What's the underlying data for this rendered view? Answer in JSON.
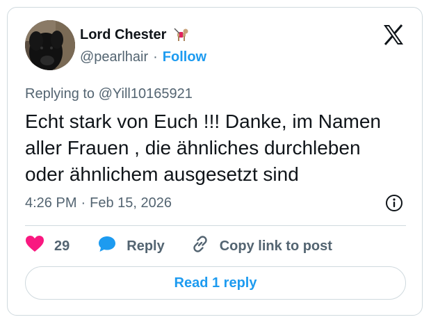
{
  "author": {
    "display_name": "Lord Chester",
    "name_emoji_icon": "guide-dog-icon",
    "handle": "@pearlhair",
    "separator": "·",
    "follow_label": "Follow"
  },
  "platform_icon": "x-logo-icon",
  "reply_context": {
    "prefix": "Replying to ",
    "mention": "@Yill10165921"
  },
  "tweet": {
    "text": "Echt stark von Euch !!! Danke, im Namen\naller Frauen , die ähnliches durchleben\noder ähnlichem ausgesetzt sind"
  },
  "meta": {
    "time": "4:26 PM",
    "separator": "·",
    "date": "Feb 15, 2026",
    "info_icon": "info-icon"
  },
  "actions": {
    "like_count": "29",
    "like_icon": "heart-icon",
    "reply_label": "Reply",
    "reply_icon": "speech-bubble-icon",
    "copy_label": "Copy link to post",
    "copy_icon": "link-icon"
  },
  "read_replies_label": "Read 1 reply",
  "colors": {
    "accent": "#1d9bf0",
    "like": "#f91880",
    "text": "#0f1419",
    "secondary": "#536471",
    "border": "#cfd9de"
  }
}
